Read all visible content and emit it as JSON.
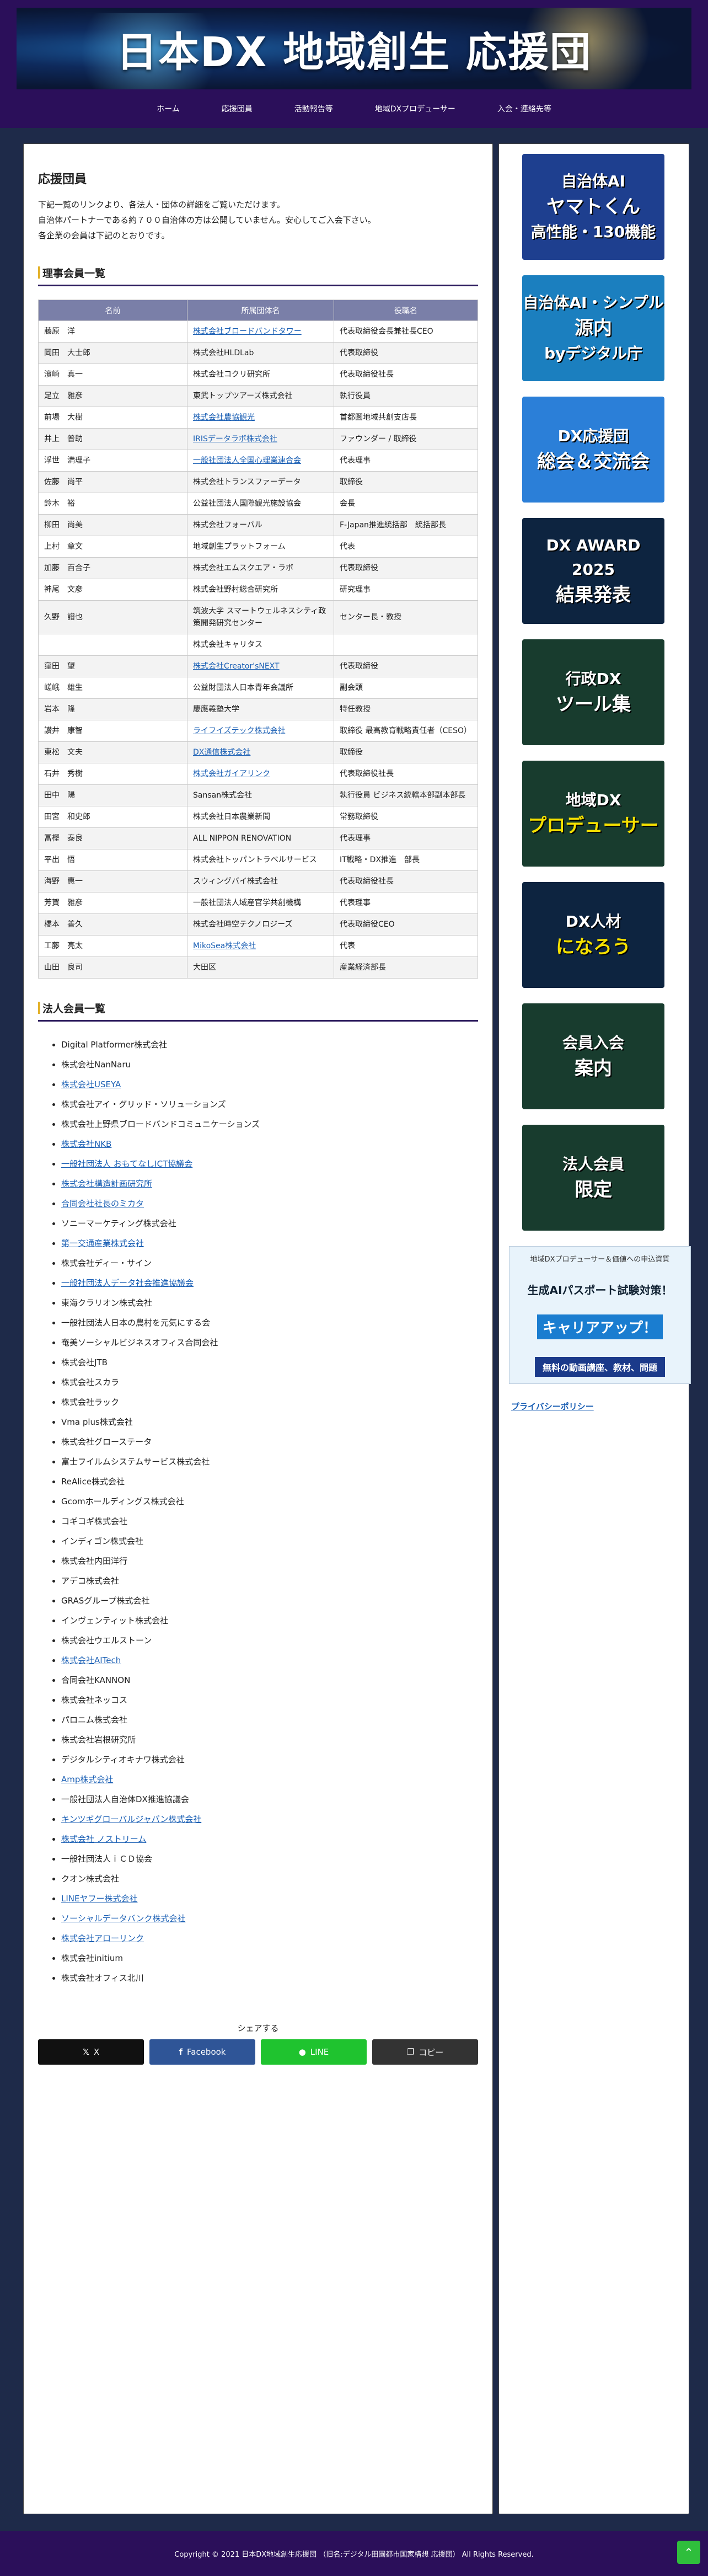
{
  "header": {
    "site_title": "日本DX 地域創生 応援団"
  },
  "nav": [
    "ホーム",
    "応援団員",
    "活動報告等",
    "地域DXプロデューサー",
    "入会・連絡先等"
  ],
  "main": {
    "page_title": "応援団員",
    "intro": [
      "下記一覧のリンクより、各法人・団体の詳細をご覧いただけます。",
      "自治体パートナーである約７００自治体の方は公開していません。安心してご入会下さい。",
      "各企業の会員は下記のとおりです。"
    ],
    "directors_title": "理事会員一覧",
    "table_headers": [
      "名前",
      "所属団体名",
      "役職名"
    ],
    "directors": [
      {
        "name": "藤原　洋",
        "org": "株式会社ブロードバンドタワー",
        "org_link": true,
        "role": "代表取締役会長兼社長CEO"
      },
      {
        "name": "岡田　大士郎",
        "org": "株式会社HLDLab",
        "org_link": false,
        "role": "代表取締役"
      },
      {
        "name": "濱崎　真一",
        "org": "株式会社コクリ研究所",
        "org_link": false,
        "role": "代表取締役社長"
      },
      {
        "name": "足立　雅彦",
        "org": "東武トップツアーズ株式会社",
        "org_link": false,
        "role": "執行役員"
      },
      {
        "name": "前場　大樹",
        "org": "株式会社農協観光",
        "org_link": true,
        "role": "首都圏地域共創支店長"
      },
      {
        "name": "井上　普助",
        "org": "IRISデータラボ株式会社",
        "org_link": true,
        "role": "ファウンダー / 取締役"
      },
      {
        "name": "浮世　満理子",
        "org": "一般社団法人全国心理業連合会",
        "org_link": true,
        "role": "代表理事"
      },
      {
        "name": "佐藤　尚平",
        "org": "株式会社トランスファーデータ",
        "org_link": false,
        "role": "取締役"
      },
      {
        "name": "鈴木　裕",
        "org": "公益社団法人国際観光施設協会",
        "org_link": false,
        "role": "会長"
      },
      {
        "name": "柳田　尚美",
        "org": "株式会社フォーバル",
        "org_link": false,
        "role": "F-Japan推進統括部　統括部長"
      },
      {
        "name": "上村　章文",
        "org": "地域創生プラットフォーム",
        "org_link": false,
        "role": "代表"
      },
      {
        "name": "加藤　百合子",
        "org": "株式会社エムスクエア・ラボ",
        "org_link": false,
        "role": "代表取締役"
      },
      {
        "name": "神尾　文彦",
        "org": "株式会社野村総合研究所",
        "org_link": false,
        "role": "研究理事"
      },
      {
        "name": "久野　譜也",
        "org": "筑波大学 スマートウェルネスシティ政策開発研究センター",
        "org_link": false,
        "role": "センター長・教授"
      },
      {
        "name": "",
        "org": "株式会社キャリタス",
        "org_link": false,
        "role": ""
      },
      {
        "name": "窪田　望",
        "org": "株式会社Creator'sNEXT",
        "org_link": true,
        "role": "代表取締役"
      },
      {
        "name": "嵯峨　雄生",
        "org": "公益財団法人日本青年会議所",
        "org_link": false,
        "role": "副会頭"
      },
      {
        "name": "岩本　隆",
        "org": "慶應義塾大学",
        "org_link": false,
        "role": "特任教授"
      },
      {
        "name": "讃井　康智",
        "org": "ライフイズテック株式会社",
        "org_link": true,
        "role": "取締役 最高教育戦略責任者（CESO）"
      },
      {
        "name": "東松　文夫",
        "org": "DX通信株式会社",
        "org_link": true,
        "role": "取締役"
      },
      {
        "name": "石井　秀樹",
        "org": "株式会社ガイアリンク",
        "org_link": true,
        "role": "代表取締役社長"
      },
      {
        "name": "田中　陽",
        "org": "Sansan株式会社",
        "org_link": false,
        "role": "執行役員 ビジネス統轄本部副本部長"
      },
      {
        "name": "田宮　和史郎",
        "org": "株式会社日本農業新聞",
        "org_link": false,
        "role": "常務取締役"
      },
      {
        "name": "冨樫　泰良",
        "org": "ALL NIPPON RENOVATION",
        "org_link": false,
        "role": "代表理事"
      },
      {
        "name": "平出　悟",
        "org": "株式会社トッパントラベルサービス",
        "org_link": false,
        "role": "IT戦略・DX推進　部長"
      },
      {
        "name": "海野　惠一",
        "org": "スウィングバイ株式会社",
        "org_link": false,
        "role": "代表取締役社長"
      },
      {
        "name": "芳賀　雅彦",
        "org": "一般社団法人域産官学共創機構",
        "org_link": false,
        "role": "代表理事"
      },
      {
        "name": "橋本　善久",
        "org": "株式会社時空テクノロジーズ",
        "org_link": false,
        "role": "代表取締役CEO"
      },
      {
        "name": "工藤　亮太",
        "org": "MikoSea株式会社",
        "org_link": true,
        "role": "代表"
      },
      {
        "name": "山田　良司",
        "org": "大田区",
        "org_link": false,
        "role": "産業経済部長"
      }
    ],
    "corporate_title": "法人会員一覧",
    "corporate": [
      {
        "text": "Digital Platformer株式会社",
        "link": false
      },
      {
        "text": "株式会社NanNaru",
        "link": false
      },
      {
        "text": "株式会社USEYA",
        "link": true
      },
      {
        "text": "株式会社アイ・グリッド・ソリューションズ",
        "link": false
      },
      {
        "text": "株式会社上野県ブロードバンドコミュニケーションズ",
        "link": false
      },
      {
        "text": "株式会社NKB",
        "link": true
      },
      {
        "text": "一般社団法人 おもてなしICT協議会",
        "link": true
      },
      {
        "text": "株式会社構造計画研究所",
        "link": true
      },
      {
        "text": "合同会社社長のミカタ",
        "link": true
      },
      {
        "text": "ソニーマーケティング株式会社",
        "link": false
      },
      {
        "text": "第一交通産業株式会社",
        "link": true
      },
      {
        "text": "株式会社ディー・サイン",
        "link": false
      },
      {
        "text": "一般社団法人データ社会推進協議会",
        "link": true
      },
      {
        "text": "東海クラリオン株式会社",
        "link": false
      },
      {
        "text": "一般社団法人日本の農村を元気にする会",
        "link": false
      },
      {
        "text": "奄美ソーシャルビジネスオフィス合同会社",
        "link": false
      },
      {
        "text": "株式会社JTB",
        "link": false
      },
      {
        "text": "株式会社スカラ",
        "link": false
      },
      {
        "text": "株式会社ラック",
        "link": false
      },
      {
        "text": "Vma plus株式会社",
        "link": false
      },
      {
        "text": "株式会社グローステータ",
        "link": false
      },
      {
        "text": "富士フイルムシステムサービス株式会社",
        "link": false
      },
      {
        "text": "ReAlice株式会社",
        "link": false
      },
      {
        "text": "Gcomホールディングス株式会社",
        "link": false
      },
      {
        "text": "コギコギ株式会社",
        "link": false
      },
      {
        "text": "インディゴン株式会社",
        "link": false
      },
      {
        "text": "株式会社内田洋行",
        "link": false
      },
      {
        "text": "アデコ株式会社",
        "link": false
      },
      {
        "text": "GRASグループ株式会社",
        "link": false
      },
      {
        "text": "インヴェンティット株式会社",
        "link": false
      },
      {
        "text": "株式会社ウエルストーン",
        "link": false
      },
      {
        "text": "株式会社AITech",
        "link": true
      },
      {
        "text": "合同会社KANNON",
        "link": false
      },
      {
        "text": "株式会社ネッコス",
        "link": false
      },
      {
        "text": "パロニム株式会社",
        "link": false
      },
      {
        "text": "株式会社岩根研究所",
        "link": false
      },
      {
        "text": "デジタルシティオキナワ株式会社",
        "link": false
      },
      {
        "text": "Amp株式会社",
        "link": true
      },
      {
        "text": "一般社団法人自治体DX推進協議会",
        "link": false
      },
      {
        "text": "キンツギグローバルジャパン株式会社",
        "link": true
      },
      {
        "text": "株式会社 ノストリーム",
        "link": true
      },
      {
        "text": "一般社団法人ｉＣＤ協会",
        "link": false
      },
      {
        "text": "クオン株式会社",
        "link": false
      },
      {
        "text": "LINEヤフー株式会社",
        "link": true
      },
      {
        "text": "ソーシャルデータバンク株式会社",
        "link": true
      },
      {
        "text": "株式会社アローリンク",
        "link": true
      },
      {
        "text": "株式会社initium",
        "link": false
      },
      {
        "text": "株式会社オフィス北川",
        "link": false
      }
    ],
    "share": {
      "label": "シェアする",
      "x": "X",
      "facebook": "Facebook",
      "line": "LINE",
      "copy": "コピー"
    }
  },
  "sidebar": {
    "banners": [
      {
        "line1": "自治体AI",
        "line2": "ヤマトくん",
        "line3": "高性能・130機能"
      },
      {
        "line1": "自治体AI・シンプル",
        "line2": "源内",
        "line3": "byデジタル庁"
      },
      {
        "line1": "DX応援団",
        "line2": "総会＆交流会",
        "line3": ""
      },
      {
        "line1": "DX AWARD 2025",
        "line2": "結果発表",
        "line3": ""
      },
      {
        "line1": "行政DX",
        "line2": "ツール集",
        "line3": ""
      },
      {
        "line1": "地域DX",
        "line2": "プロデューサー",
        "line3": ""
      },
      {
        "line1": "DX人材",
        "line2": "になろう",
        "line3": ""
      },
      {
        "line1": "会員入会",
        "line2": "案内",
        "line3": ""
      },
      {
        "line1": "法人会員",
        "line2": "限定",
        "line3": ""
      }
    ],
    "ad": {
      "line1": "地域DXプロデューサー＆価値への申込資質",
      "line2": "生成AIパスポート試験対策！",
      "line3": "キャリアアップ！",
      "line4": "無料の動画講座、教材、問題"
    },
    "privacy": "プライバシーポリシー"
  },
  "footer": {
    "copyright": "Copyright © 2021 日本DX地域創生応援団 （旧名:デジタル田園都市国家構想 応援団） All Rights Reserved."
  },
  "colors": {
    "header": "#2b0f5a",
    "background": "#1e2a49",
    "table_head": "#7a7fa8",
    "accent": "#e3b22b",
    "x": "#111111",
    "facebook": "#2f5597",
    "line": "#1fc32f",
    "copy": "#333333"
  }
}
